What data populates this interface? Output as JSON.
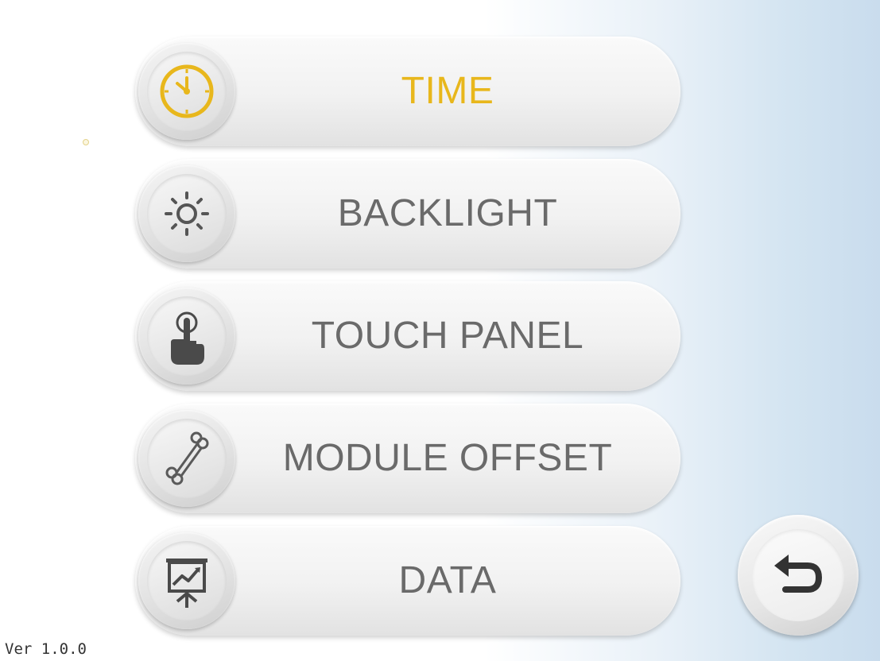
{
  "menu": {
    "items": [
      {
        "label": "TIME",
        "icon": "clock-icon",
        "active": true
      },
      {
        "label": "BACKLIGHT",
        "icon": "sun-icon",
        "active": false
      },
      {
        "label": "TOUCH PANEL",
        "icon": "hand-touch-icon",
        "active": false
      },
      {
        "label": "MODULE OFFSET",
        "icon": "bone-icon",
        "active": false
      },
      {
        "label": "DATA",
        "icon": "presentation-chart-icon",
        "active": false
      }
    ]
  },
  "back_button": {
    "icon": "undo-arrow-icon"
  },
  "footer": {
    "version": "Ver 1.0.0"
  },
  "colors": {
    "active": "#e8b71c",
    "text": "#6a6a6a",
    "icon_dark": "#4a4a4a"
  }
}
